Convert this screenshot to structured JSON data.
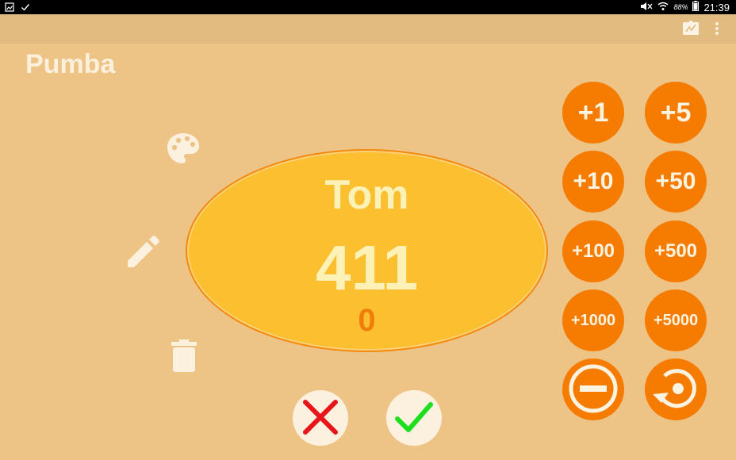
{
  "status_bar": {
    "battery": "88%",
    "time": "21:39"
  },
  "page": {
    "title": "Pumba"
  },
  "player": {
    "name": "Tom",
    "score": "411",
    "pending_delta": "0"
  },
  "increment_buttons": [
    "+1",
    "+5",
    "+10",
    "+50",
    "+100",
    "+500",
    "+1000",
    "+5000"
  ],
  "colors": {
    "background": "#EEC386",
    "toolbar": "#E1BB7F",
    "oval_fill": "#FBBF2F",
    "oval_border": "#F3890D",
    "button": "#F57C00",
    "cancel": "#E8161B",
    "confirm": "#1EDF1E"
  },
  "icons": {
    "toolbar": [
      "presentation-icon",
      "overflow-menu-icon"
    ],
    "side": [
      "palette-icon",
      "pencil-icon",
      "trash-icon"
    ],
    "controls": [
      "minus-circle-icon",
      "undo-icon"
    ],
    "actions": [
      "cancel-x-icon",
      "confirm-check-icon"
    ]
  }
}
